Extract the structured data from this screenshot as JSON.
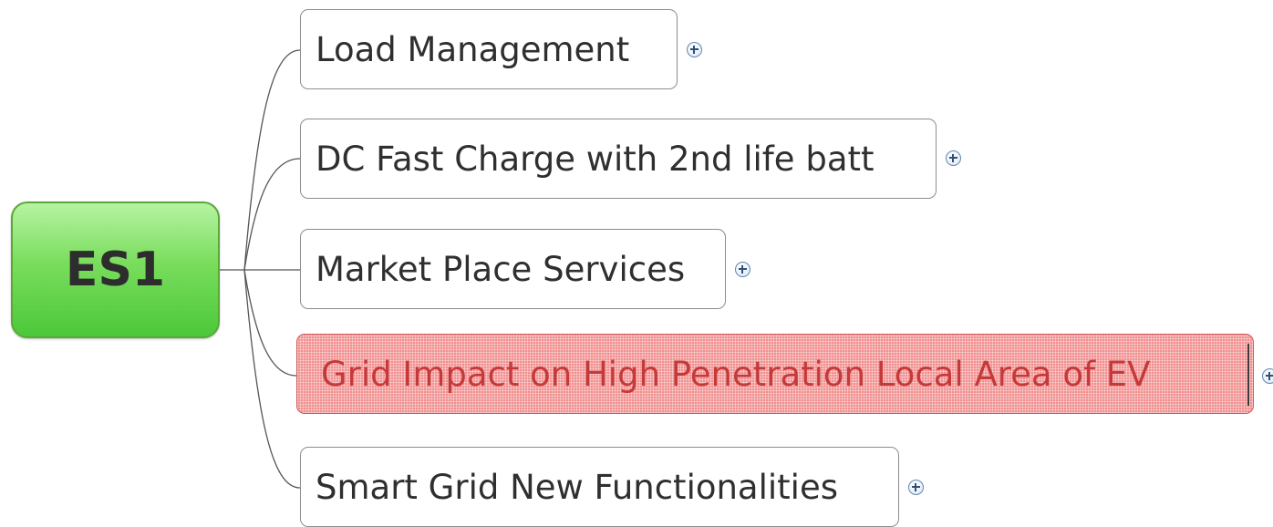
{
  "root": {
    "label": "ES1"
  },
  "topics": [
    {
      "label": "Load Management"
    },
    {
      "label": "DC Fast Charge with 2nd life batt"
    },
    {
      "label": "Market Place Services"
    },
    {
      "label": "Grid Impact on High Penetration Local Area of EV",
      "selected": true
    },
    {
      "label": "Smart Grid New Functionalities"
    }
  ],
  "colors": {
    "root_fill": "#79dd5c",
    "selected_fill": "#f28f8f",
    "selected_text": "#c43a3a",
    "connector": "#555555"
  },
  "icons": {
    "expand": "plus-circle-icon"
  }
}
